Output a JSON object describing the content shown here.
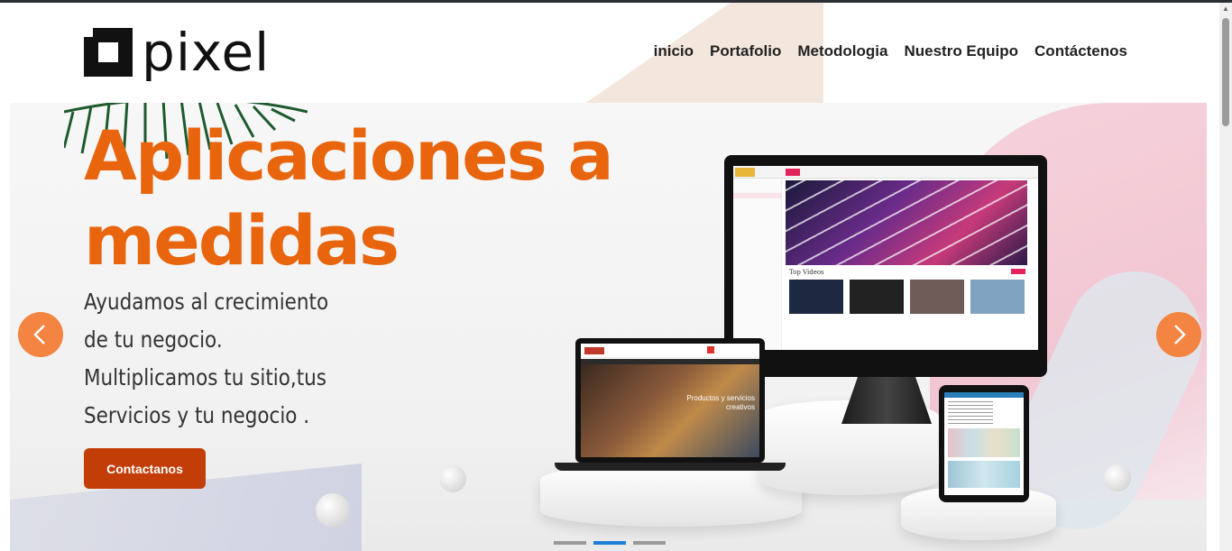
{
  "brand": {
    "name": "pixel"
  },
  "nav": {
    "items": [
      "inicio",
      "Portafolio",
      "Metodologia",
      "Nuestro Equipo",
      "Contáctenos"
    ]
  },
  "hero": {
    "title_line1": "Aplicaciones a",
    "title_line2": "medidas",
    "subtitle": [
      "Ayudamos al crecimiento",
      "de tu negocio.",
      "Multiplicamos tu sitio,tus",
      "Servicios y tu negocio ."
    ],
    "cta_label": "Contactanos",
    "slides_total": 3,
    "active_slide": 2
  },
  "mockups": {
    "imac_section_label": "Top Videos",
    "laptop_caption": "Productos y servicios creativos"
  },
  "colors": {
    "accent": "#e8650e",
    "button": "#c33d08",
    "arrow": "#f38441",
    "indicator_active": "#1e7fd6"
  }
}
